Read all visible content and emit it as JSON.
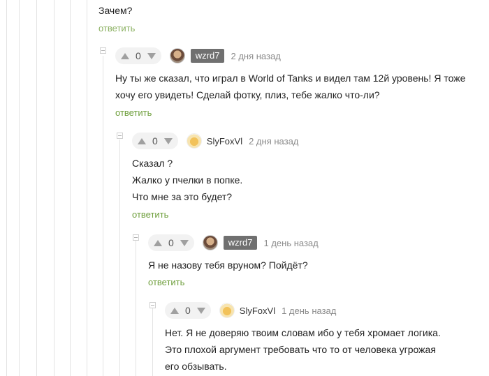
{
  "top_comment": {
    "text": "Зачем?",
    "reply_label": "ответить"
  },
  "comments": [
    {
      "rating": "0",
      "author": "wzrd7",
      "time": "2 дня назад",
      "lines": [
        "Ну ты же сказал, что играл в World of Tanks и видел там 12й уровень! Я тоже",
        "хочу его увидеть! Сделай фотку, плиз, тебе жалко что-ли?"
      ],
      "reply_label": "ответить"
    },
    {
      "rating": "0",
      "author": "SlyFoxVl",
      "time": "2 дня назад",
      "lines": [
        "Сказал ?",
        "Жалко у пчелки в попке.",
        "Что мне за это будет?"
      ],
      "reply_label": "ответить"
    },
    {
      "rating": "0",
      "author": "wzrd7",
      "time": "1 день назад",
      "lines": [
        "Я не назову тебя вруном? Пойдёт?"
      ],
      "reply_label": "ответить"
    },
    {
      "rating": "0",
      "author": "SlyFoxVl",
      "time": "1 день назад",
      "lines": [
        "Нет. Я не доверяю твоим словам ибо у тебя хромает логика.",
        "Это плохой аргумент требовать что то от человека угрожая",
        "его обзывать."
      ]
    }
  ]
}
